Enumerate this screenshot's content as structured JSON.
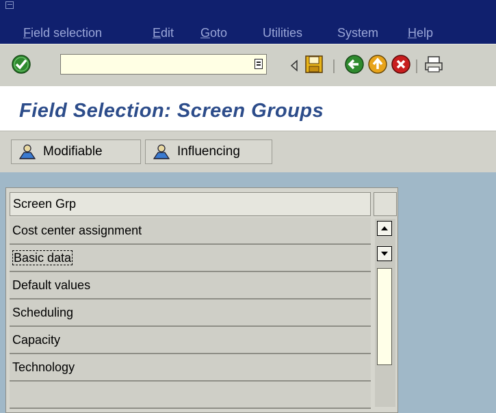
{
  "menu": {
    "items": [
      {
        "mnemonic": "F",
        "rest": "ield selection"
      },
      {
        "mnemonic": "E",
        "rest": "dit"
      },
      {
        "mnemonic": "G",
        "rest": "oto"
      },
      {
        "mnemonic": "",
        "rest": "Utilities"
      },
      {
        "mnemonic": "",
        "rest": "System"
      },
      {
        "mnemonic": "H",
        "rest": "elp"
      }
    ]
  },
  "toolbar": {
    "command_field_value": "",
    "icons": [
      "enter-icon",
      "save-icon",
      "back-icon",
      "exit-icon",
      "cancel-icon",
      "print-icon"
    ],
    "colors": {
      "enter": "#2e8a2e",
      "back": "#2e8a2e",
      "exit": "#e8a41a",
      "cancel": "#c81e1e",
      "save": "#e8b418"
    }
  },
  "page": {
    "title": "Field Selection: Screen Groups"
  },
  "app_toolbar": {
    "modifiable_label": "Modifiable",
    "influencing_label": "Influencing"
  },
  "table": {
    "header": "Screen Grp",
    "rows": [
      "Cost center assignment",
      "Basic data",
      "Default values",
      "Scheduling",
      "Capacity",
      "Technology",
      ""
    ],
    "focused_row": "Basic data"
  }
}
